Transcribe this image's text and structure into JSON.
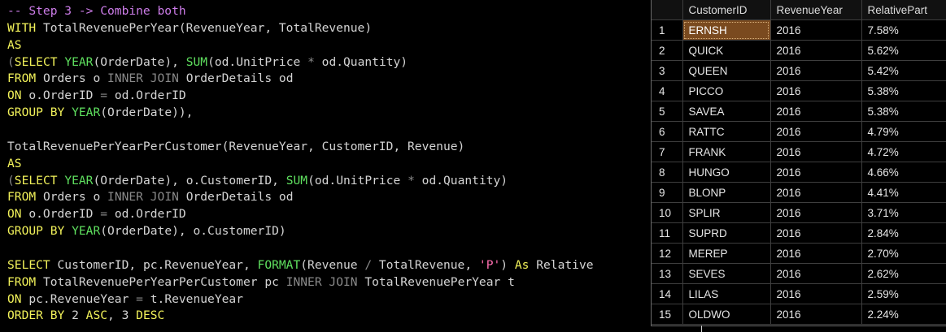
{
  "editor": {
    "lines": [
      [
        {
          "t": "-- Step 3 -> Combine both",
          "c": "comment"
        }
      ],
      [
        {
          "t": "WITH",
          "c": "keyword"
        },
        {
          "t": " TotalRevenuePerYear(RevenueYear, TotalRevenue)",
          "c": "text"
        }
      ],
      [
        {
          "t": "AS",
          "c": "keyword"
        }
      ],
      [
        {
          "t": "(",
          "c": "op"
        },
        {
          "t": "SELECT",
          "c": "keyword"
        },
        {
          "t": " ",
          "c": "text"
        },
        {
          "t": "YEAR",
          "c": "func"
        },
        {
          "t": "(OrderDate), ",
          "c": "text"
        },
        {
          "t": "SUM",
          "c": "func"
        },
        {
          "t": "(od.UnitPrice ",
          "c": "text"
        },
        {
          "t": "*",
          "c": "op"
        },
        {
          "t": " od.Quantity)",
          "c": "text"
        }
      ],
      [
        {
          "t": "FROM",
          "c": "keyword"
        },
        {
          "t": " Orders o ",
          "c": "text"
        },
        {
          "t": "INNER JOIN",
          "c": "op"
        },
        {
          "t": " OrderDetails od",
          "c": "text"
        }
      ],
      [
        {
          "t": "ON",
          "c": "keyword"
        },
        {
          "t": " o.OrderID ",
          "c": "text"
        },
        {
          "t": "=",
          "c": "op"
        },
        {
          "t": " od.OrderID",
          "c": "text"
        }
      ],
      [
        {
          "t": "GROUP BY",
          "c": "keyword"
        },
        {
          "t": " ",
          "c": "text"
        },
        {
          "t": "YEAR",
          "c": "func"
        },
        {
          "t": "(OrderDate)),",
          "c": "text"
        }
      ],
      [
        {
          "t": "",
          "c": "text"
        }
      ],
      [
        {
          "t": "TotalRevenuePerYearPerCustomer(RevenueYear, CustomerID, Revenue)",
          "c": "text"
        }
      ],
      [
        {
          "t": "AS",
          "c": "keyword"
        }
      ],
      [
        {
          "t": "(",
          "c": "op"
        },
        {
          "t": "SELECT",
          "c": "keyword"
        },
        {
          "t": " ",
          "c": "text"
        },
        {
          "t": "YEAR",
          "c": "func"
        },
        {
          "t": "(OrderDate), o.CustomerID, ",
          "c": "text"
        },
        {
          "t": "SUM",
          "c": "func"
        },
        {
          "t": "(od.UnitPrice ",
          "c": "text"
        },
        {
          "t": "*",
          "c": "op"
        },
        {
          "t": " od.Quantity)",
          "c": "text"
        }
      ],
      [
        {
          "t": "FROM",
          "c": "keyword"
        },
        {
          "t": " Orders o ",
          "c": "text"
        },
        {
          "t": "INNER JOIN",
          "c": "op"
        },
        {
          "t": " OrderDetails od",
          "c": "text"
        }
      ],
      [
        {
          "t": "ON",
          "c": "keyword"
        },
        {
          "t": " o.OrderID ",
          "c": "text"
        },
        {
          "t": "=",
          "c": "op"
        },
        {
          "t": " od.OrderID",
          "c": "text"
        }
      ],
      [
        {
          "t": "GROUP BY",
          "c": "keyword"
        },
        {
          "t": " ",
          "c": "text"
        },
        {
          "t": "YEAR",
          "c": "func"
        },
        {
          "t": "(OrderDate), o.CustomerID)",
          "c": "text"
        }
      ],
      [
        {
          "t": "",
          "c": "text"
        }
      ],
      [
        {
          "t": "SELECT",
          "c": "keyword"
        },
        {
          "t": " CustomerID, pc.RevenueYear, ",
          "c": "text"
        },
        {
          "t": "FORMAT",
          "c": "func"
        },
        {
          "t": "(Revenue ",
          "c": "text"
        },
        {
          "t": "/",
          "c": "op"
        },
        {
          "t": " TotalRevenue, ",
          "c": "text"
        },
        {
          "t": "'P'",
          "c": "string"
        },
        {
          "t": ") ",
          "c": "text"
        },
        {
          "t": "As",
          "c": "keyword"
        },
        {
          "t": " Relative",
          "c": "text"
        }
      ],
      [
        {
          "t": "FROM",
          "c": "keyword"
        },
        {
          "t": " TotalRevenuePerYearPerCustomer pc ",
          "c": "text"
        },
        {
          "t": "INNER JOIN",
          "c": "op"
        },
        {
          "t": " TotalRevenuePerYear t",
          "c": "text"
        }
      ],
      [
        {
          "t": "ON",
          "c": "keyword"
        },
        {
          "t": " pc.RevenueYear ",
          "c": "text"
        },
        {
          "t": "=",
          "c": "op"
        },
        {
          "t": " t.RevenueYear",
          "c": "text"
        }
      ],
      [
        {
          "t": "ORDER BY",
          "c": "keyword"
        },
        {
          "t": " 2 ",
          "c": "text"
        },
        {
          "t": "ASC",
          "c": "keyword"
        },
        {
          "t": ", 3 ",
          "c": "text"
        },
        {
          "t": "DESC",
          "c": "keyword"
        }
      ]
    ]
  },
  "results": {
    "columns": [
      "",
      "CustomerID",
      "RevenueYear",
      "RelativePart"
    ],
    "selected": {
      "row": 0,
      "col": 1
    },
    "rows": [
      [
        "1",
        "ERNSH",
        "2016",
        "7.58%"
      ],
      [
        "2",
        "QUICK",
        "2016",
        "5.62%"
      ],
      [
        "3",
        "QUEEN",
        "2016",
        "5.42%"
      ],
      [
        "4",
        "PICCO",
        "2016",
        "5.38%"
      ],
      [
        "5",
        "SAVEA",
        "2016",
        "5.38%"
      ],
      [
        "6",
        "RATTC",
        "2016",
        "4.79%"
      ],
      [
        "7",
        "FRANK",
        "2016",
        "4.72%"
      ],
      [
        "8",
        "HUNGO",
        "2016",
        "4.66%"
      ],
      [
        "9",
        "BLONP",
        "2016",
        "4.41%"
      ],
      [
        "10",
        "SPLIR",
        "2016",
        "3.71%"
      ],
      [
        "11",
        "SUPRD",
        "2016",
        "2.84%"
      ],
      [
        "12",
        "MEREP",
        "2016",
        "2.70%"
      ],
      [
        "13",
        "SEVES",
        "2016",
        "2.62%"
      ],
      [
        "14",
        "LILAS",
        "2016",
        "2.59%"
      ],
      [
        "15",
        "OLDWO",
        "2016",
        "2.24%"
      ]
    ]
  },
  "colors": {
    "background": "#000000",
    "comment": "#cc7ce8",
    "keyword": "#f2f25a",
    "function": "#5fe05f",
    "operator": "#8a8a8a",
    "string": "#ff6fb0",
    "text": "#d4d4d4",
    "selected_cell": "#7a4a1f"
  }
}
